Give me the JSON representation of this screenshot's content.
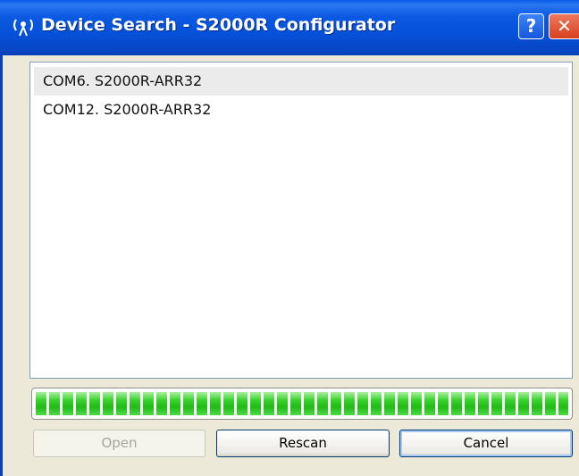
{
  "window": {
    "title": "Device Search - S2000R Configurator",
    "title_icon": "antenna-icon",
    "help_glyph": "?",
    "close_glyph": "✕"
  },
  "device_list": {
    "items": [
      {
        "label": "COM6. S2000R-ARR32",
        "selected": true
      },
      {
        "label": "COM12. S2000R-ARR32",
        "selected": false
      }
    ]
  },
  "progress": {
    "percent": 100,
    "color": "#27c11d"
  },
  "buttons": {
    "open_label": "Open",
    "open_enabled": false,
    "rescan_label": "Rescan",
    "cancel_label": "Cancel"
  },
  "colors": {
    "titlebar": "#0651d9",
    "dialog_bg": "#ece9d8",
    "selection": "#ebebeb"
  }
}
